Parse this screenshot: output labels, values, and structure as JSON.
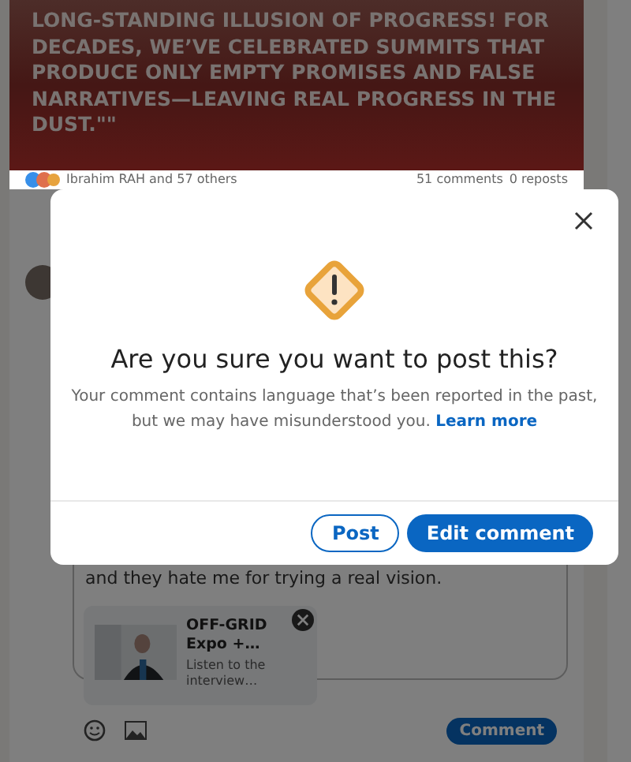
{
  "post": {
    "quote": "LONG-STANDING ILLUSION OF PROGRESS! FOR DECADES, WE’VE CELEBRATED SUMMITS THAT PRODUCE ONLY EMPTY PROMISES AND FALSE NARRATIVES—LEAVING REAL PROGRESS IN THE DUST.\"\"",
    "reactions": "Ibrahim RAH and 57 others",
    "comments": "51 comments",
    "reposts": "0 reposts"
  },
  "comment_box": {
    "text": "and they hate me for trying a real vision.",
    "preview": {
      "title": "OFF-GRID Expo +…",
      "description": "Listen to the interview…"
    },
    "submit": "Comment"
  },
  "dialog": {
    "title": "Are you sure you want to post this?",
    "message": "Your comment contains language that’s been reported in the past, but we may have misunderstood you.",
    "link": "Learn more",
    "buttons": [
      {
        "label": "Post",
        "kind": "secondary"
      },
      {
        "label": "Edit comment",
        "kind": "primary"
      }
    ]
  }
}
